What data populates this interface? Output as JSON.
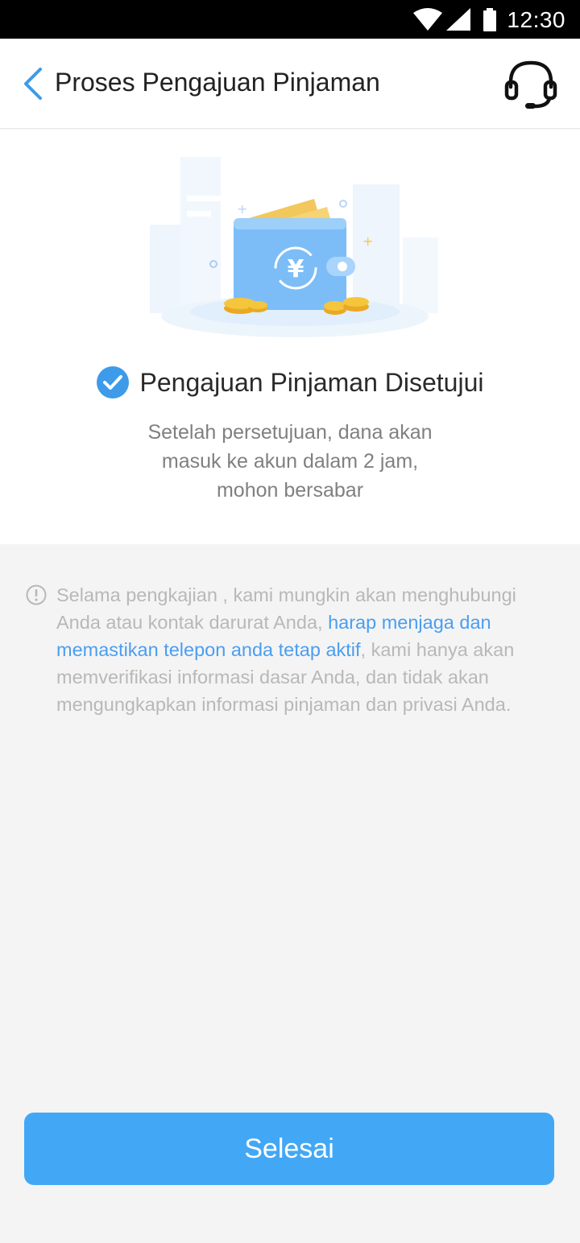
{
  "status_bar": {
    "time": "12:30",
    "icons": [
      "wifi-icon",
      "signal-icon",
      "battery-icon"
    ]
  },
  "header": {
    "title": "Proses Pengajuan Pinjaman",
    "back_icon": "chevron-left-icon",
    "support_icon": "headset-icon"
  },
  "result": {
    "illustration": "wallet-illustration",
    "icon": "check-circle-icon",
    "title": "Pengajuan Pinjaman Disetujui",
    "description_lines": [
      "Setelah persetujuan, dana akan",
      "masuk ke akun dalam 2 jam,",
      "mohon bersabar"
    ]
  },
  "notice": {
    "icon": "info-icon",
    "text_before": "Selama pengkajian , kami mungkin akan menghubungi Anda atau kontak darurat Anda, ",
    "text_highlight": "harap menjaga dan memastikan telepon anda tetap aktif",
    "text_after": ", kami hanya akan memverifikasi informasi dasar Anda, dan tidak akan mengungkapkan informasi pinjaman dan privasi Anda."
  },
  "actions": {
    "done_label": "Selesai"
  },
  "colors": {
    "accent": "#42a8f6",
    "link": "#4a9ef0",
    "title_text": "#222222",
    "muted_text": "#808080",
    "notice_text": "#b8b8b8",
    "background": "#f4f4f4"
  }
}
